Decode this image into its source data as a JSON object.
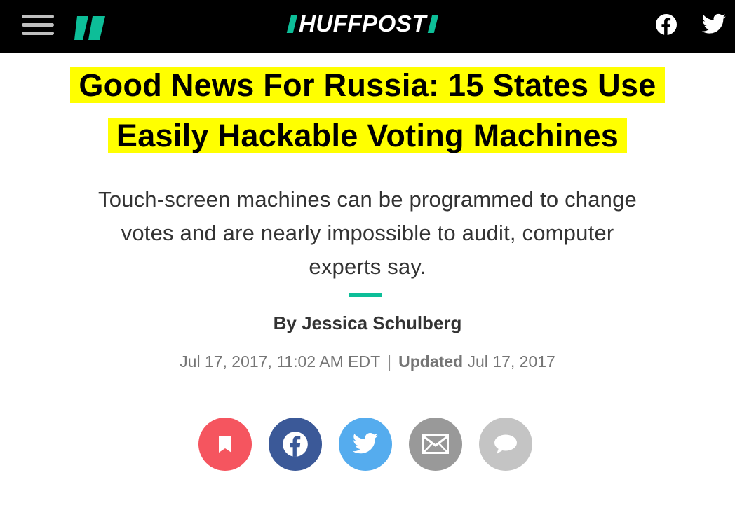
{
  "header": {
    "brand": "HUFFPOST",
    "menu_icon": "hamburger-menu-icon",
    "logo_icon": "huffpost-mark-icon",
    "facebook_icon": "facebook-icon",
    "twitter_icon": "twitter-icon",
    "accent_color": "#0dbe98",
    "background_color": "#000000"
  },
  "article": {
    "headline_line1": "Good News For Russia: 15 States Use",
    "headline_line2": "Easily Hackable Voting Machines",
    "headline_highlight_color": "#ffff00",
    "subhead_line1": "Touch-screen machines can be programmed to change",
    "subhead_line2": "votes and are nearly impossible to audit, computer",
    "subhead_line3": "experts say.",
    "byline_prefix": "By",
    "author": "Jessica Schulberg",
    "published": "Jul 17, 2017, 11:02 AM EDT",
    "separator": "|",
    "updated_label": "Updated",
    "updated": "Jul 17, 2017"
  },
  "share": {
    "buttons": [
      {
        "icon": "bookmark-icon",
        "color": "#f5555f"
      },
      {
        "icon": "facebook-icon",
        "color": "#3b5998"
      },
      {
        "icon": "twitter-icon",
        "color": "#55acee"
      },
      {
        "icon": "email-icon",
        "color": "#999999"
      },
      {
        "icon": "comment-icon",
        "color": "#c4c4c4"
      }
    ]
  }
}
